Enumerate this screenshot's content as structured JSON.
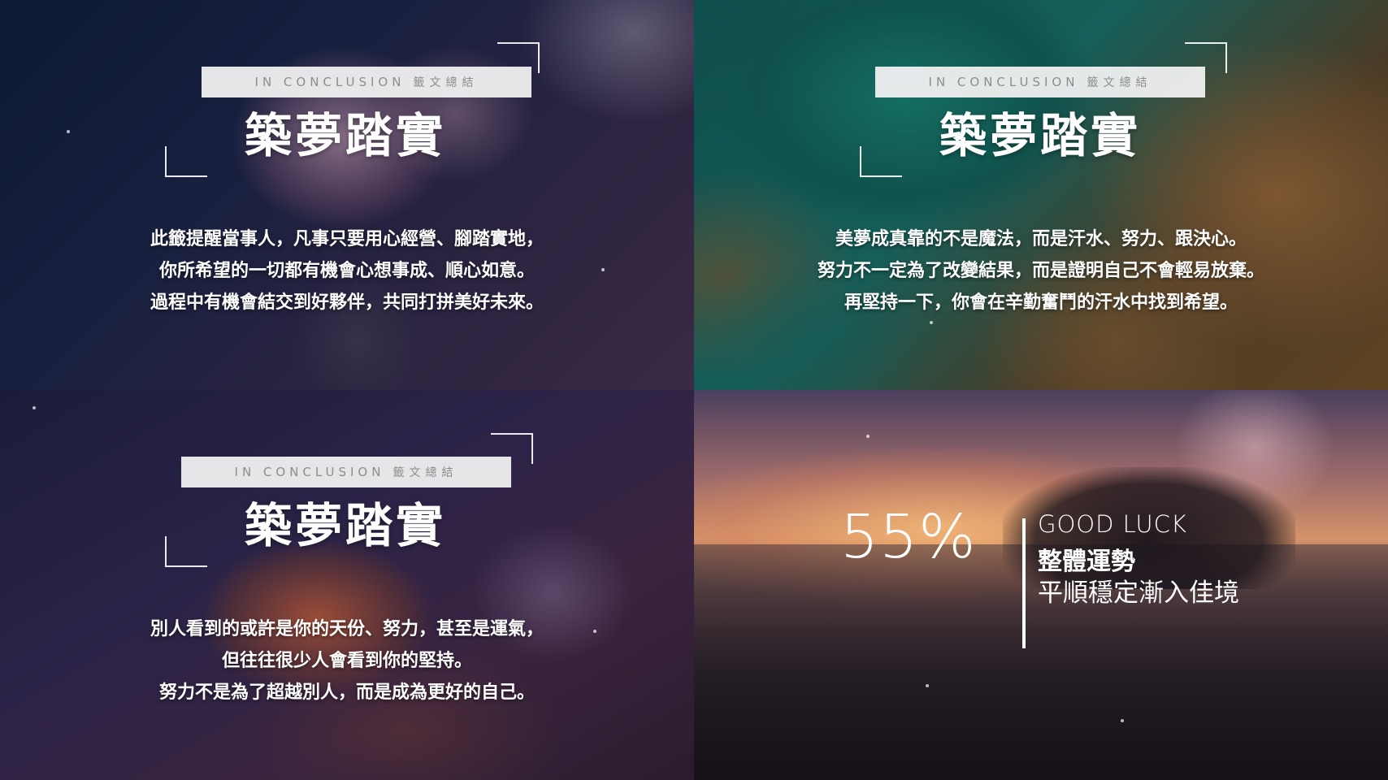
{
  "panels": [
    {
      "tag_en": "IN CONCLUSION",
      "tag_zh": "籤文總結",
      "title": "築夢踏實",
      "lines": [
        "此籤提醒當事人，凡事只要用心經營、腳踏實地，",
        "你所希望的一切都有機會心想事成、順心如意。",
        "過程中有機會結交到好夥伴，共同打拼美好未來。"
      ]
    },
    {
      "tag_en": "IN CONCLUSION",
      "tag_zh": "籤文總結",
      "title": "築夢踏實",
      "lines": [
        "美夢成真靠的不是魔法，而是汗水、努力、跟決心。",
        "努力不一定為了改變結果，而是證明自己不會輕易放棄。",
        "再堅持一下，你會在辛勤奮鬥的汗水中找到希望。"
      ]
    },
    {
      "tag_en": "IN CONCLUSION",
      "tag_zh": "籤文總結",
      "title": "築夢踏實",
      "lines": [
        "別人看到的或許是你的天份、努力，甚至是運氣，",
        "但往往很少人會看到你的堅持。",
        "努力不是為了超越別人，而是成為更好的自己。"
      ]
    }
  ],
  "fortune": {
    "percent": "55%",
    "label_en": "GOOD LUCK",
    "title": "整體運勢",
    "description": "平順穩定漸入佳境"
  },
  "colors": {
    "tag_bg": "#f0f0f0",
    "tag_text": "#8d8d8d",
    "text": "#ffffff"
  }
}
